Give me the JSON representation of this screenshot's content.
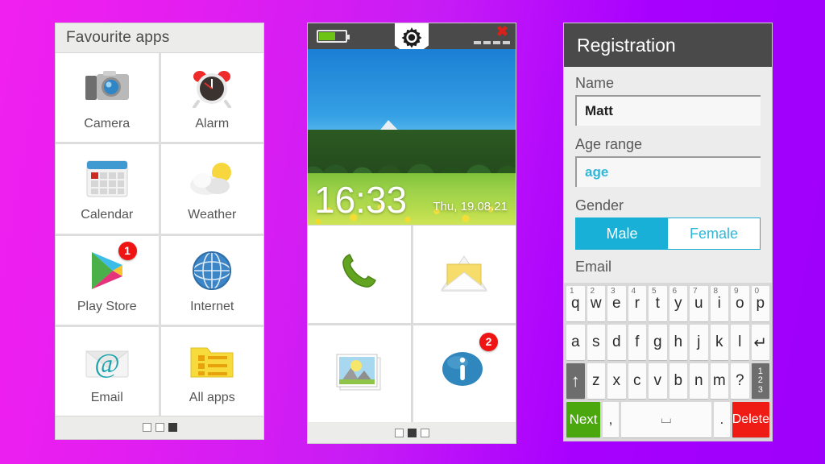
{
  "background": {
    "from": "#f020f0",
    "to": "#9d00fb"
  },
  "favourites_phone": {
    "title": "Favourite apps",
    "apps": [
      {
        "label": "Camera",
        "icon": "camera-icon",
        "badge": null
      },
      {
        "label": "Alarm",
        "icon": "alarm-clock-icon",
        "badge": null
      },
      {
        "label": "Calendar",
        "icon": "calendar-icon",
        "badge": null
      },
      {
        "label": "Weather",
        "icon": "weather-icon",
        "badge": null
      },
      {
        "label": "Play Store",
        "icon": "play-store-icon",
        "badge": "1"
      },
      {
        "label": "Internet",
        "icon": "globe-icon",
        "badge": null
      },
      {
        "label": "Email",
        "icon": "email-at-icon",
        "badge": null
      },
      {
        "label": "All apps",
        "icon": "all-apps-icon",
        "badge": null
      }
    ],
    "pager": {
      "pages": 3,
      "active": 3
    }
  },
  "home_phone": {
    "status_bar": {
      "battery_icon": "battery-icon",
      "battery_level_percent": 58,
      "settings_icon": "gear-icon",
      "disconnect_icon": "red-x-icon",
      "signal_icon": "signal-bars-icon",
      "signal_bars": 4
    },
    "lockscreen": {
      "time": "16:33",
      "date": "Thu, 19.08.21"
    },
    "tiles": [
      {
        "icon": "phone-handset-icon",
        "badge": null
      },
      {
        "icon": "envelope-icon",
        "badge": null
      },
      {
        "icon": "gallery-photo-icon",
        "badge": null
      },
      {
        "icon": "info-bubble-icon",
        "badge": "2"
      }
    ],
    "pager": {
      "pages": 3,
      "active": 2
    }
  },
  "registration_phone": {
    "header": {
      "title": "Registration"
    },
    "fields": [
      {
        "label": "Name",
        "value": "Matt",
        "placeholder": "",
        "style": "value"
      },
      {
        "label": "Age range",
        "value": "age",
        "placeholder": "age",
        "style": "hint"
      }
    ],
    "gender": {
      "label": "Gender",
      "options": [
        {
          "label": "Male",
          "selected": true
        },
        {
          "label": "Female",
          "selected": false
        }
      ],
      "accent_color": "#18b0d6"
    },
    "email_label": "Email",
    "keyboard": {
      "row1": [
        {
          "key": "q",
          "sup": "1"
        },
        {
          "key": "w",
          "sup": "2"
        },
        {
          "key": "e",
          "sup": "3"
        },
        {
          "key": "r",
          "sup": "4"
        },
        {
          "key": "t",
          "sup": "5"
        },
        {
          "key": "y",
          "sup": "6"
        },
        {
          "key": "u",
          "sup": "7"
        },
        {
          "key": "i",
          "sup": "8"
        },
        {
          "key": "o",
          "sup": "9"
        },
        {
          "key": "p",
          "sup": "0"
        }
      ],
      "row2": [
        "a",
        "s",
        "d",
        "f",
        "g",
        "h",
        "j",
        "k",
        "l"
      ],
      "row2_enter": "↵",
      "row3_shift": "↑",
      "row3": [
        "z",
        "x",
        "c",
        "v",
        "b",
        "n",
        "m",
        "?"
      ],
      "row3_numeric": [
        "1",
        "2",
        "3"
      ],
      "row4": {
        "next": "Next",
        "comma": ",",
        "space": "⌴",
        "period": ".",
        "delete": "Delete"
      }
    }
  }
}
